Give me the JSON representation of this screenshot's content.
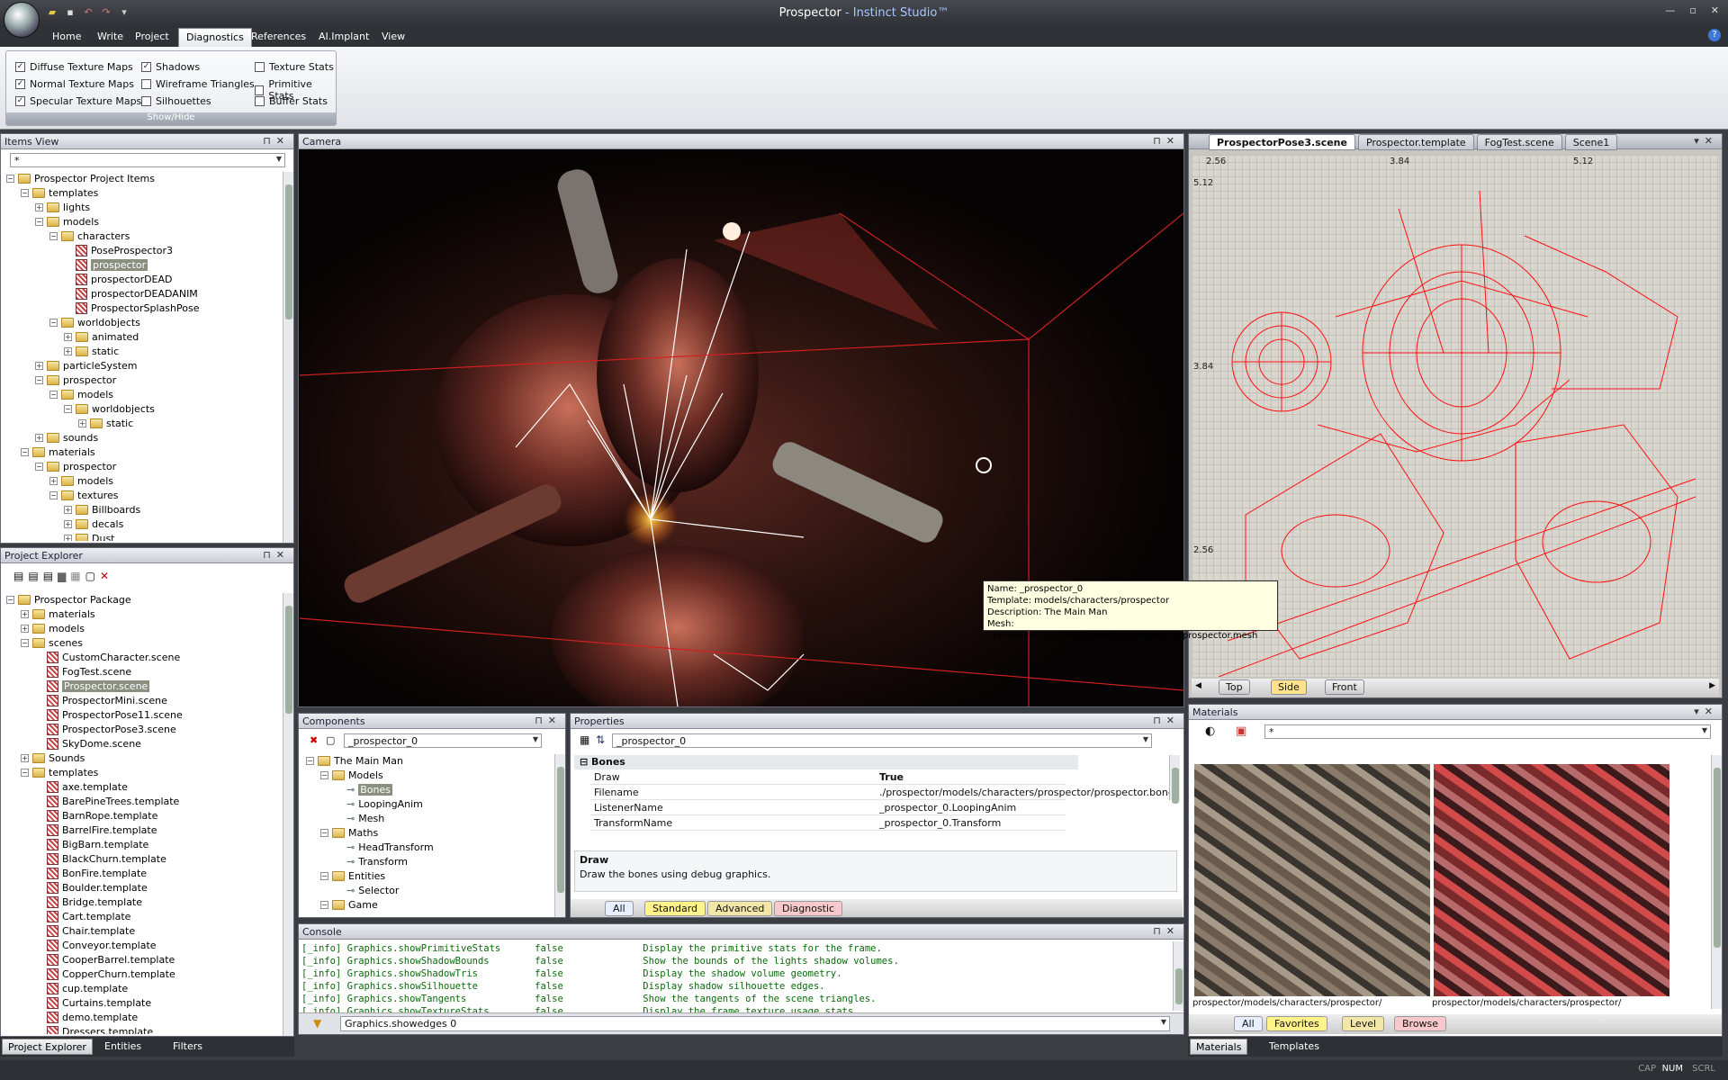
{
  "app": {
    "title": "Prospector",
    "title_suffix": " - Instinct Studio™"
  },
  "menu": [
    "Home",
    "Write",
    "Project",
    "Diagnostics",
    "References",
    "AI.Implant",
    "View"
  ],
  "ribbon": {
    "group_label": "Show/Hide",
    "checks": [
      {
        "label": "Diffuse Texture Maps",
        "checked": true
      },
      {
        "label": "Normal Texture Maps",
        "checked": true
      },
      {
        "label": "Specular Texture Maps",
        "checked": true
      },
      {
        "label": "Shadows",
        "checked": true
      },
      {
        "label": "Wireframe Triangles",
        "checked": false
      },
      {
        "label": "Silhouettes",
        "checked": false
      },
      {
        "label": "Texture Stats",
        "checked": false
      },
      {
        "label": "Primitive Stats",
        "checked": false
      },
      {
        "label": "Buffer Stats",
        "checked": false
      }
    ]
  },
  "items_view": {
    "title": "Items View",
    "filter": "*",
    "rows": [
      {
        "label": "Prospector Project Items",
        "d": 0,
        "t": "-"
      },
      {
        "label": "templates",
        "d": 1,
        "t": "-"
      },
      {
        "label": "lights",
        "d": 2,
        "t": "+"
      },
      {
        "label": "models",
        "d": 2,
        "t": "-"
      },
      {
        "label": "characters",
        "d": 3,
        "t": "-"
      },
      {
        "label": "PoseProspector3",
        "d": 4,
        "t": "",
        "tpl": true
      },
      {
        "label": "prospector",
        "d": 4,
        "t": "",
        "tpl": true,
        "sel": true
      },
      {
        "label": "prospectorDEAD",
        "d": 4,
        "t": "",
        "tpl": true
      },
      {
        "label": "prospectorDEADANIM",
        "d": 4,
        "t": "",
        "tpl": true
      },
      {
        "label": "ProspectorSplashPose",
        "d": 4,
        "t": "",
        "tpl": true
      },
      {
        "label": "worldobjects",
        "d": 3,
        "t": "-"
      },
      {
        "label": "animated",
        "d": 4,
        "t": "+"
      },
      {
        "label": "static",
        "d": 4,
        "t": "+"
      },
      {
        "label": "particleSystem",
        "d": 2,
        "t": "+"
      },
      {
        "label": "prospector",
        "d": 2,
        "t": "-"
      },
      {
        "label": "models",
        "d": 3,
        "t": "-"
      },
      {
        "label": "worldobjects",
        "d": 4,
        "t": "-"
      },
      {
        "label": "static",
        "d": 5,
        "t": "+"
      },
      {
        "label": "sounds",
        "d": 2,
        "t": "+"
      },
      {
        "label": "materials",
        "d": 1,
        "t": "-"
      },
      {
        "label": "prospector",
        "d": 2,
        "t": "-"
      },
      {
        "label": "models",
        "d": 3,
        "t": "+"
      },
      {
        "label": "textures",
        "d": 3,
        "t": "-"
      },
      {
        "label": "Billboards",
        "d": 4,
        "t": "+"
      },
      {
        "label": "decals",
        "d": 4,
        "t": "+"
      },
      {
        "label": "Dust",
        "d": 4,
        "t": "+"
      }
    ]
  },
  "project_explorer": {
    "title": "Project Explorer",
    "rows": [
      {
        "label": "Prospector Package",
        "d": 0,
        "t": "-"
      },
      {
        "label": "materials",
        "d": 1,
        "t": "+"
      },
      {
        "label": "models",
        "d": 1,
        "t": "+"
      },
      {
        "label": "scenes",
        "d": 1,
        "t": "-"
      },
      {
        "label": "CustomCharacter.scene",
        "d": 2,
        "t": "",
        "tpl": true
      },
      {
        "label": "FogTest.scene",
        "d": 2,
        "t": "",
        "tpl": true
      },
      {
        "label": "Prospector.scene",
        "d": 2,
        "t": "",
        "tpl": true,
        "sel": true
      },
      {
        "label": "ProspectorMini.scene",
        "d": 2,
        "t": "",
        "tpl": true
      },
      {
        "label": "ProspectorPose11.scene",
        "d": 2,
        "t": "",
        "tpl": true
      },
      {
        "label": "ProspectorPose3.scene",
        "d": 2,
        "t": "",
        "tpl": true
      },
      {
        "label": "SkyDome.scene",
        "d": 2,
        "t": "",
        "tpl": true
      },
      {
        "label": "Sounds",
        "d": 1,
        "t": "+"
      },
      {
        "label": "templates",
        "d": 1,
        "t": "-"
      },
      {
        "label": "axe.template",
        "d": 2,
        "t": "",
        "tpl": true
      },
      {
        "label": "BarePineTrees.template",
        "d": 2,
        "t": "",
        "tpl": true
      },
      {
        "label": "BarnRope.template",
        "d": 2,
        "t": "",
        "tpl": true
      },
      {
        "label": "BarrelFire.template",
        "d": 2,
        "t": "",
        "tpl": true
      },
      {
        "label": "BigBarn.template",
        "d": 2,
        "t": "",
        "tpl": true
      },
      {
        "label": "BlackChurn.template",
        "d": 2,
        "t": "",
        "tpl": true
      },
      {
        "label": "BonFire.template",
        "d": 2,
        "t": "",
        "tpl": true
      },
      {
        "label": "Boulder.template",
        "d": 2,
        "t": "",
        "tpl": true
      },
      {
        "label": "Bridge.template",
        "d": 2,
        "t": "",
        "tpl": true
      },
      {
        "label": "Cart.template",
        "d": 2,
        "t": "",
        "tpl": true
      },
      {
        "label": "Chair.template",
        "d": 2,
        "t": "",
        "tpl": true
      },
      {
        "label": "Conveyor.template",
        "d": 2,
        "t": "",
        "tpl": true
      },
      {
        "label": "CooperBarrel.template",
        "d": 2,
        "t": "",
        "tpl": true
      },
      {
        "label": "CopperChurn.template",
        "d": 2,
        "t": "",
        "tpl": true
      },
      {
        "label": "cup.template",
        "d": 2,
        "t": "",
        "tpl": true
      },
      {
        "label": "Curtains.template",
        "d": 2,
        "t": "",
        "tpl": true
      },
      {
        "label": "demo.template",
        "d": 2,
        "t": "",
        "tpl": true
      },
      {
        "label": "Dressers.template",
        "d": 2,
        "t": "",
        "tpl": true
      }
    ]
  },
  "left_tabs": [
    "Project Explorer",
    "Entities",
    "Filters"
  ],
  "camera": {
    "title": "Camera"
  },
  "tooltip": {
    "lines": [
      "Name: _prospector_0",
      "Template: models/characters/prospector",
      "Description: The Main Man",
      "Mesh: ./prospector/models/characters/prospector/prospector.mesh"
    ]
  },
  "scene_tabs": [
    "ProspectorPose3.scene",
    "Prospector.template",
    "FogTest.scene",
    "Scene1"
  ],
  "wire": {
    "coords_top": [
      "2.56",
      "3.84",
      "5.12"
    ],
    "coords_left": [
      "5.12",
      "3.84",
      "2.56"
    ],
    "views": [
      "Top",
      "Side",
      "Front"
    ],
    "active_view": "Side"
  },
  "components": {
    "title": "Components",
    "selector": "_prospector_0",
    "rows": [
      {
        "label": "The Main Man",
        "d": 0,
        "t": "-"
      },
      {
        "label": "Models",
        "d": 1,
        "t": "-"
      },
      {
        "label": "Bones",
        "d": 2,
        "t": "",
        "sel": true
      },
      {
        "label": "LoopingAnim",
        "d": 2,
        "t": ""
      },
      {
        "label": "Mesh",
        "d": 2,
        "t": ""
      },
      {
        "label": "Maths",
        "d": 1,
        "t": "-"
      },
      {
        "label": "HeadTransform",
        "d": 2,
        "t": ""
      },
      {
        "label": "Transform",
        "d": 2,
        "t": ""
      },
      {
        "label": "Entities",
        "d": 1,
        "t": "-"
      },
      {
        "label": "Selector",
        "d": 2,
        "t": ""
      },
      {
        "label": "Game",
        "d": 1,
        "t": "-"
      }
    ]
  },
  "properties": {
    "title": "Properties",
    "selector": "_prospector_0",
    "category": "Bones",
    "rows": [
      {
        "k": "Draw",
        "v": "True"
      },
      {
        "k": "Filename",
        "v": "./prospector/models/characters/prospector/prospector.bones"
      },
      {
        "k": "ListenerName",
        "v": "_prospector_0.LoopingAnim"
      },
      {
        "k": "TransformName",
        "v": "_prospector_0.Transform"
      }
    ],
    "desc_title": "Draw",
    "desc_text": "Draw the bones using debug graphics.",
    "filters": [
      "All",
      "Standard",
      "Advanced",
      "Diagnostic"
    ]
  },
  "console": {
    "title": "Console",
    "lines": [
      "[_info] Graphics.showPrimitiveStats      false              Display the primitive stats for the frame.",
      "[_info] Graphics.showShadowBounds        false              Show the bounds of the lights shadow volumes.",
      "[_info] Graphics.showShadowTris          false              Display the shadow volume geometry.",
      "[_info] Graphics.showSilhouette          false              Display shadow silhouette edges.",
      "[_info] Graphics.showTangents            false              Show the tangents of the scene triangles.",
      "[_info] Graphics.showTextureStats        false              Display the frame texture usage stats."
    ],
    "input": "Graphics.showedges 0"
  },
  "materials": {
    "title": "Materials",
    "filter": "*",
    "captions": [
      "prospector/models/characters/prospector/",
      "prospector/models/characters/prospector/"
    ],
    "filters": [
      "All",
      "Favorites",
      "Level",
      "Browse"
    ]
  },
  "right_tabs": [
    "Materials",
    "Templates"
  ],
  "status": [
    "CAP",
    "NUM",
    "SCRL"
  ]
}
